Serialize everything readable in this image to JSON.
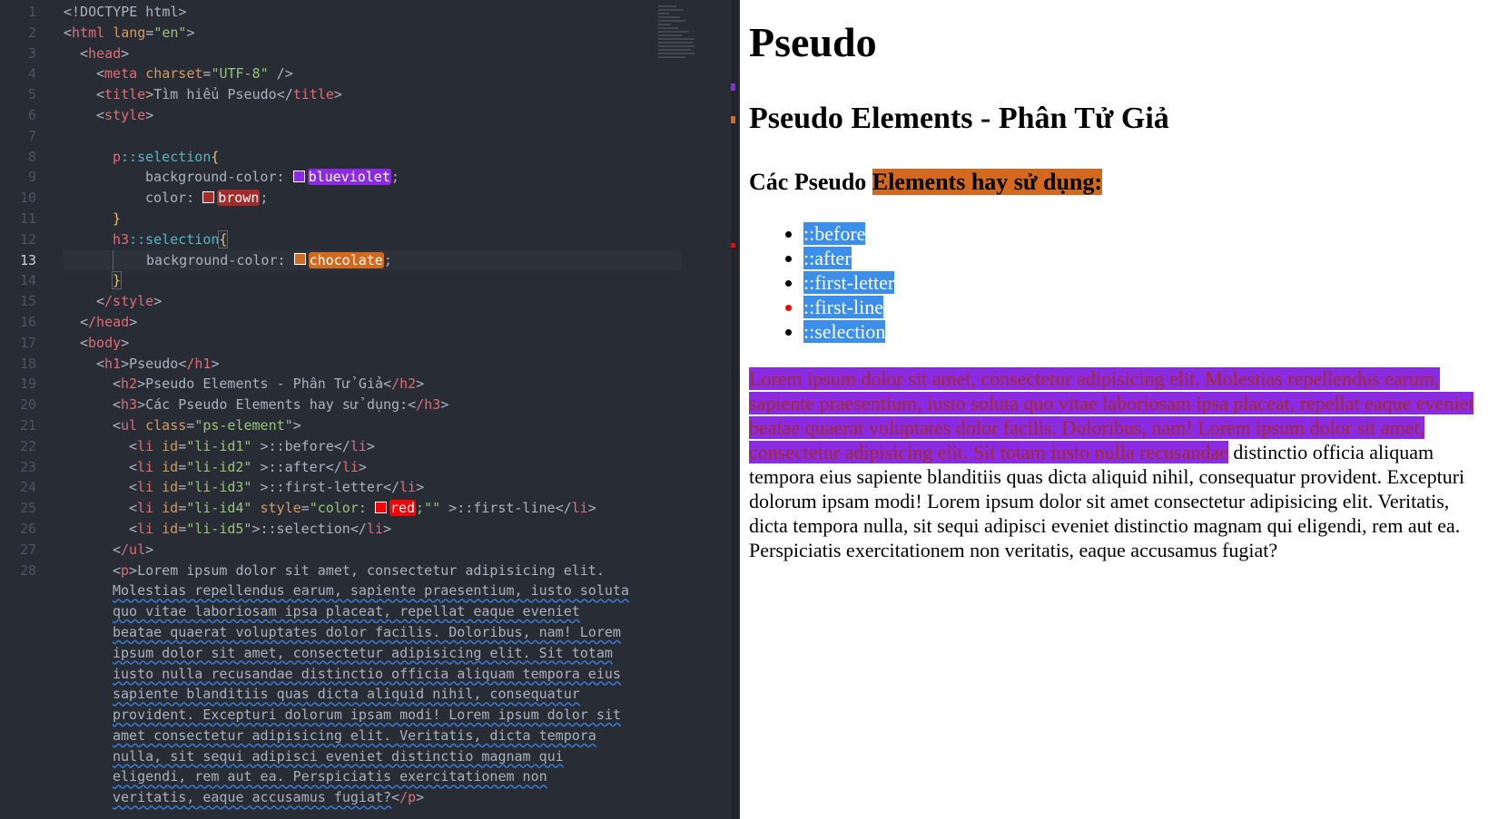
{
  "editor": {
    "line_numbers": [
      "1",
      "2",
      "3",
      "4",
      "5",
      "6",
      "7",
      "8",
      "9",
      "10",
      "11",
      "12",
      "13",
      "14",
      "15",
      "16",
      "17",
      "18",
      "19",
      "20",
      "21",
      "22",
      "23",
      "24",
      "25",
      "26",
      "27",
      "28"
    ],
    "active_line": "13",
    "colors": {
      "blueviolet": "#8a2be2",
      "brown": "#a52a2a",
      "chocolate": "#d2691e",
      "red": "#ff0000",
      "background": "#282c34"
    },
    "l1": "<!DOCTYPE html>",
    "l2_tag": "html",
    "l2_attr": "lang",
    "l2_val": "\"en\"",
    "l3_tag": "head",
    "l4_tag": "meta",
    "l4_attr": "charset",
    "l4_val": "\"UTF-8\"",
    "l5_tag": "title",
    "l5_text": "Tìm hiểu Pseudo",
    "l6_tag": "style",
    "l8_sel": "p",
    "l8_pseudo": "::selection",
    "l9_prop": "background-color:",
    "l9_val": "blueviolet",
    "l10_prop": "color:",
    "l10_val": "brown",
    "l12_sel": "h3",
    "l12_pseudo": "::selection",
    "l13_prop": "background-color:",
    "l13_val": "chocolate",
    "l15_tag": "/style",
    "l16_tag": "/head",
    "l17_tag": "body",
    "l18_tag": "h1",
    "l18_text": "Pseudo",
    "l18_close": "/h1",
    "l19_tag": "h2",
    "l19_text": "Pseudo Elements - Phân Tử Giả",
    "l19_close": "/h2",
    "l20_tag": "h3",
    "l20_text": "Các Pseudo Elements hay sử dụng:",
    "l20_close": "/h3",
    "l21_tag": "ul",
    "l21_attr": "class",
    "l21_val": "\"ps-element\"",
    "li_items": [
      {
        "id": "\"li-id1\"",
        "text": "::before"
      },
      {
        "id": "\"li-id2\"",
        "text": "::after"
      },
      {
        "id": "\"li-id3\"",
        "text": "::first-letter"
      },
      {
        "id": "\"li-id4\"",
        "text": "::first-line"
      },
      {
        "id": "\"li-id5\"",
        "text": "::selection"
      }
    ],
    "l25_style_attr": "style",
    "l25_style_pre": "\"color: ",
    "l25_style_val": "red",
    "l25_style_post": ";\"\"",
    "l27_tag": "/ul",
    "p_tag": "p",
    "p_close": "/p",
    "p_lines": [
      "Lorem ipsum dolor sit amet, consectetur adipisicing elit.",
      "Molestias repellendus earum, sapiente praesentium, iusto soluta",
      "quo vitae laboriosam ipsa placeat, repellat eaque eveniet",
      "beatae quaerat voluptates dolor facilis. Doloribus, nam! Lorem",
      "ipsum dolor sit amet, consectetur adipisicing elit. Sit totam",
      "iusto nulla recusandae distinctio officia aliquam tempora eius",
      "sapiente blanditiis quas dicta aliquid nihil, consequatur",
      "provident. Excepturi dolorum ipsam modi! Lorem ipsum dolor sit",
      "amet consectetur adipisicing elit. Veritatis, dicta tempora",
      "nulla, sit sequi adipisci eveniet distinctio magnam qui",
      "eligendi, rem aut ea. Perspiciatis exercitationem non",
      "veritatis, eaque accusamus fugiat?"
    ]
  },
  "preview": {
    "h1": "Pseudo",
    "h2": "Pseudo Elements - Phân Tử Giả",
    "h3_plain": "Các Pseudo ",
    "h3_selected": "Elements hay sử dụng: ",
    "list": [
      "::before ",
      "::after ",
      "::first-letter ",
      "::first-line ",
      "::selection "
    ],
    "p_selected": "Lorem ipsum dolor sit amet, consectetur adipisicing elit. Molestias repellendus earum, sapiente praesentium, iusto soluta quo vitae laboriosam ipsa placeat, repellat eaque eveniet beatae quaerat voluptates dolor facilis. Doloribus, nam! Lorem ipsum dolor sit amet, consectetur adipisicing elit. Sit totam iusto nulla recusandae",
    "p_rest": " distinctio officia aliquam tempora eius sapiente blanditiis quas dicta aliquid nihil, consequatur provident. Excepturi dolorum ipsam modi! Lorem ipsum dolor sit amet consectetur adipisicing elit. Veritatis, dicta tempora nulla, sit sequi adipisci eveniet distinctio magnam qui eligendi, rem aut ea. Perspiciatis exercitationem non veritatis, eaque accusamus fugiat?"
  }
}
